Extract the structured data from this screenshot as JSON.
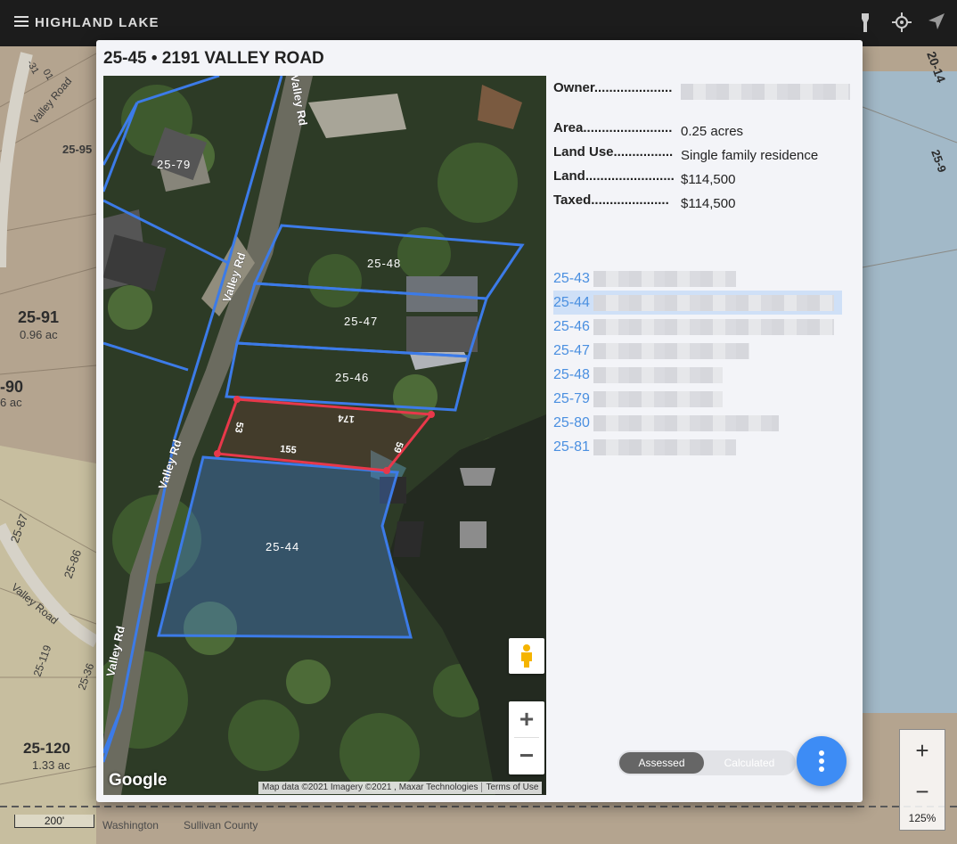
{
  "app": {
    "title": "HIGHLAND LAKE"
  },
  "bg_map": {
    "labels": [
      "Valley Road",
      "25-95",
      "25-91",
      "0.96 ac",
      "-90",
      "6 ac",
      "25-87",
      "25-86",
      "Valley Road",
      "25-119",
      "25-36",
      "25-120",
      "1.33 ac",
      "Washington",
      "Sullivan County",
      "20-14",
      "25-9",
      "-31",
      "01"
    ],
    "scale_label": "200'",
    "zoom_in": "+",
    "zoom_out": "−",
    "zoom_pct": "125%"
  },
  "dialog": {
    "title": "25-45 • 2191 VALLEY ROAD",
    "fields": [
      {
        "key": "Owner.....................",
        "value": ""
      },
      {
        "key": "Area........................",
        "value": "0.25 acres"
      },
      {
        "key": "Land Use................",
        "value": "Single family residence"
      },
      {
        "key": "Land........................",
        "value": "$114,500"
      },
      {
        "key": "Taxed.....................",
        "value": "$114,500"
      }
    ],
    "links": [
      {
        "id": "25-43",
        "selected": false
      },
      {
        "id": "25-44",
        "selected": true
      },
      {
        "id": "25-46",
        "selected": false
      },
      {
        "id": "25-47",
        "selected": false
      },
      {
        "id": "25-48",
        "selected": false
      },
      {
        "id": "25-79",
        "selected": false
      },
      {
        "id": "25-80",
        "selected": false
      },
      {
        "id": "25-81",
        "selected": false
      }
    ],
    "toggle": {
      "assessed": "Assessed",
      "calculated": "Calculated",
      "active": "Assessed"
    }
  },
  "satmap": {
    "road_labels": [
      "Valley Rd",
      "Valley Rd",
      "Valley Rd",
      "Valley Rd"
    ],
    "parcels": [
      "25-79",
      "25-48",
      "25-47",
      "25-46",
      "25-44"
    ],
    "dimensions": [
      "53",
      "174",
      "155",
      "59"
    ],
    "zoom_in": "+",
    "zoom_out": "−",
    "logo": "Google",
    "attribution": "Map data ©2021 Imagery ©2021 , Maxar Technologies",
    "terms": "Terms of Use"
  },
  "colors": {
    "parcel": "#3c7be8",
    "selected_parcel": "#e8384a",
    "link": "#4a8fe0",
    "fab": "#3d8cf5",
    "appbar": "#1c1c1c"
  }
}
